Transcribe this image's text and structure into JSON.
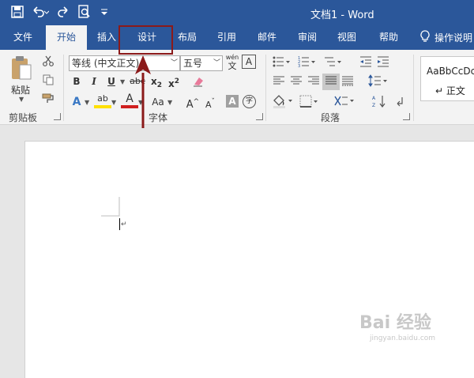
{
  "window": {
    "title": "文档1 - Word"
  },
  "quick_access": {
    "icons": [
      "save-icon",
      "undo-icon",
      "redo-icon",
      "print-preview-icon",
      "customize-qat-icon"
    ]
  },
  "tabs": [
    {
      "label": "文件"
    },
    {
      "label": "开始",
      "active": true
    },
    {
      "label": "插入"
    },
    {
      "label": "设计",
      "highlighted": true
    },
    {
      "label": "布局"
    },
    {
      "label": "引用"
    },
    {
      "label": "邮件"
    },
    {
      "label": "审阅"
    },
    {
      "label": "视图"
    },
    {
      "label": "帮助"
    }
  ],
  "tell_me": {
    "label": "操作说明"
  },
  "ribbon": {
    "clipboard": {
      "paste_label": "粘贴",
      "group_label": "剪贴板"
    },
    "font": {
      "font_name": "等线 (中文正文)",
      "font_size": "五号",
      "wen_label": "wén",
      "wen_char": "文",
      "a_label": "A",
      "bold": "B",
      "italic": "I",
      "underline": "U",
      "strike": "abc",
      "sub_x": "x",
      "sub_2": "2",
      "sup_x": "x",
      "sup_2": "2",
      "text_effect": "A",
      "highlight": "ab",
      "font_color": "A",
      "change_case": "Aa",
      "grow": "A",
      "shrink": "A",
      "shading": "A",
      "enclose": "字",
      "group_label": "字体"
    },
    "paragraph": {
      "group_label": "段落"
    },
    "styles": {
      "sample": "AaBbCcDc",
      "normal": "↵ 正文"
    }
  },
  "watermark": {
    "brand": "Bai 经验",
    "url": "jingyan.baidu.com"
  },
  "colors": {
    "brand": "#2b579a",
    "ribbon": "#f3f3f3",
    "annotation": "#8b1a1a"
  }
}
